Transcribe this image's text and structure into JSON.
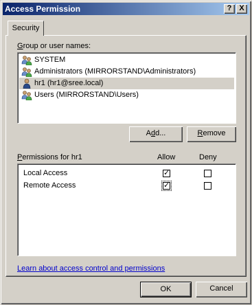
{
  "window": {
    "title": "Access Permission",
    "help_label": "?",
    "close_label": "X"
  },
  "tabs": [
    {
      "label": "Security"
    }
  ],
  "groups": {
    "label_prefix": "G",
    "label_rest": "roup or user names:",
    "items": [
      {
        "label": "SYSTEM",
        "icon": "group-icon"
      },
      {
        "label": "Administrators (MIRRORSTAND\\Administrators)",
        "icon": "group-icon"
      },
      {
        "label": "hr1 (hr1@sree.local)",
        "icon": "user-icon",
        "selected": true
      },
      {
        "label": "Users (MIRRORSTAND\\Users)",
        "icon": "group-icon"
      }
    ]
  },
  "buttons": {
    "add_pre": "A",
    "add_u": "d",
    "add_post": "d...",
    "remove_u": "R",
    "remove_post": "emove",
    "ok": "OK",
    "cancel": "Cancel"
  },
  "permissions": {
    "label_pre": "",
    "label_u": "P",
    "label_post": "ermissions for hr1",
    "allow_header": "Allow",
    "deny_header": "Deny",
    "rows": [
      {
        "name": "Local Access",
        "allow": true,
        "deny": false
      },
      {
        "name": "Remote Access",
        "allow": true,
        "deny": false
      }
    ]
  },
  "link": {
    "text": "Learn about access control and permissions"
  },
  "colors": {
    "title_start": "#0a246a",
    "title_end": "#a6caf0",
    "link": "#0000cc",
    "face": "#d4d0c8"
  }
}
